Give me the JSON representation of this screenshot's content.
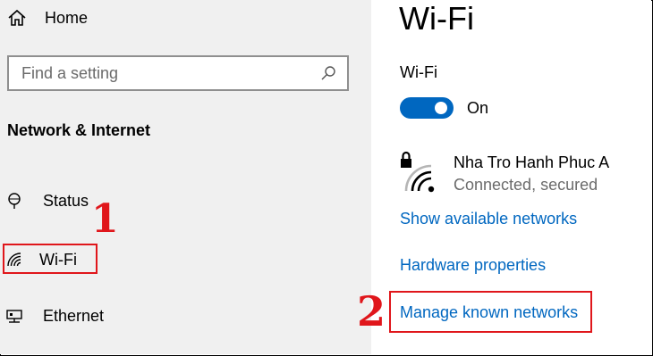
{
  "sidebar": {
    "home_label": "Home",
    "search_placeholder": "Find a setting",
    "section_title": "Network & Internet",
    "items": [
      {
        "label": "Status",
        "icon": "status-globe-icon"
      },
      {
        "label": "Wi-Fi",
        "icon": "wifi-icon"
      },
      {
        "label": "Ethernet",
        "icon": "ethernet-icon"
      }
    ]
  },
  "main": {
    "page_title": "Wi-Fi",
    "wifi_label": "Wi-Fi",
    "toggle_state": "On",
    "network": {
      "name": "Nha Tro Hanh Phuc A",
      "status": "Connected, secured",
      "icon": "secured-wifi-icon"
    },
    "links": [
      "Show available networks",
      "Hardware properties",
      "Manage known networks"
    ]
  },
  "annotations": {
    "step1": "1",
    "step2": "2",
    "highlight_color": "#e0161b"
  },
  "colors": {
    "accent": "#0067c0",
    "sidebar_bg": "#f0f0f0"
  }
}
